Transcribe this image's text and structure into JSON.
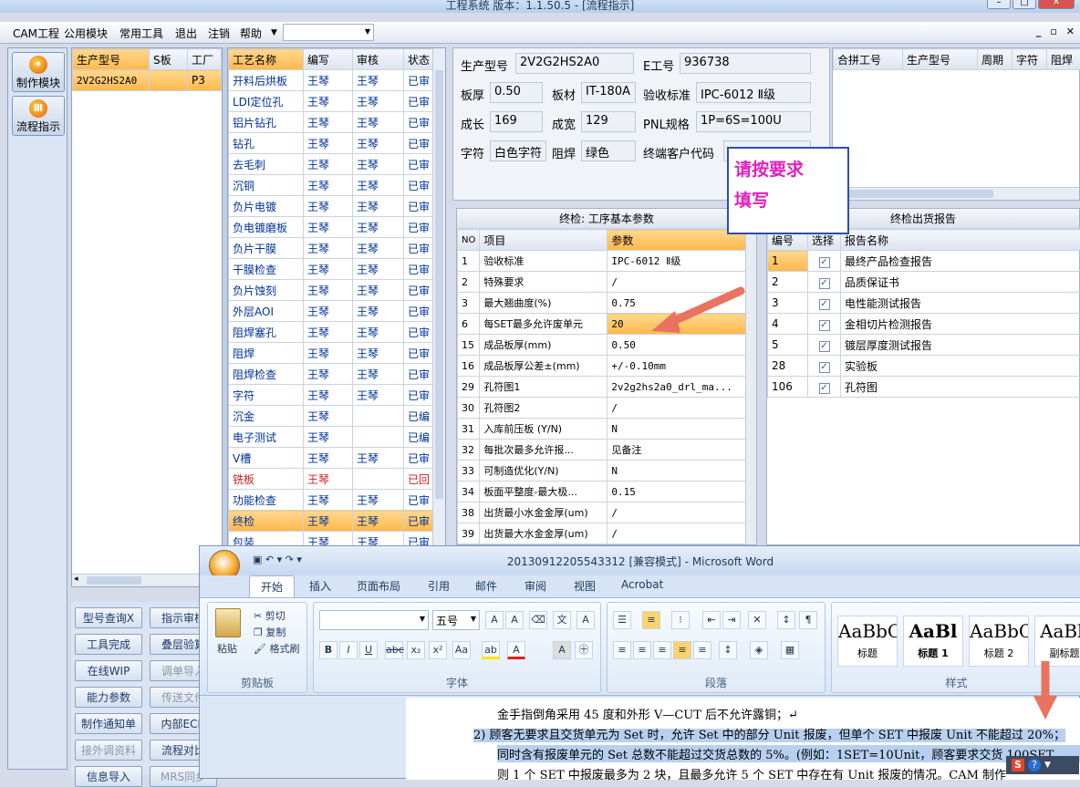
{
  "window_title": "工程系统   版本：1.1.50.5 - [流程指示]",
  "menu": {
    "items": [
      "CAM工程",
      "公用模块",
      "常用工具",
      "退出",
      "注销",
      "帮助"
    ]
  },
  "leftnav": {
    "items": [
      {
        "label": "制作模块",
        "icon": "flame-icon"
      },
      {
        "label": "流程指示",
        "icon": "flow-icon"
      }
    ]
  },
  "product_grid": {
    "headers": [
      "生产型号",
      "S板",
      "工厂"
    ],
    "rows": [
      [
        "2V2G2HS2A0",
        "",
        "P3"
      ]
    ]
  },
  "process_grid": {
    "headers": [
      "工艺名称",
      "编写",
      "审核",
      "状态"
    ],
    "rows": [
      [
        "开料后烘板",
        "王琴",
        "王琴",
        "已审"
      ],
      [
        "LDI定位孔",
        "王琴",
        "王琴",
        "已审"
      ],
      [
        "铝片钻孔",
        "王琴",
        "王琴",
        "已审"
      ],
      [
        "钻孔",
        "王琴",
        "王琴",
        "已审"
      ],
      [
        "去毛刺",
        "王琴",
        "王琴",
        "已审"
      ],
      [
        "沉铜",
        "王琴",
        "王琴",
        "已审"
      ],
      [
        "负片电镀",
        "王琴",
        "王琴",
        "已审"
      ],
      [
        "负电镀磨板",
        "王琴",
        "王琴",
        "已审"
      ],
      [
        "负片干膜",
        "王琴",
        "王琴",
        "已审"
      ],
      [
        "干膜检查",
        "王琴",
        "王琴",
        "已审"
      ],
      [
        "负片蚀刻",
        "王琴",
        "王琴",
        "已审"
      ],
      [
        "外层AOI",
        "王琴",
        "王琴",
        "已审"
      ],
      [
        "阻焊塞孔",
        "王琴",
        "王琴",
        "已审"
      ],
      [
        "阻焊",
        "王琴",
        "王琴",
        "已审"
      ],
      [
        "阻焊检查",
        "王琴",
        "王琴",
        "已审"
      ],
      [
        "字符",
        "王琴",
        "王琴",
        "已审"
      ],
      [
        "沉金",
        "王琴",
        "",
        "已编"
      ],
      [
        "电子测试",
        "王琴",
        "",
        "已编"
      ],
      [
        "V槽",
        "王琴",
        "王琴",
        "已审"
      ],
      [
        "铣板",
        "王琴",
        "",
        "已回"
      ],
      [
        "功能检查",
        "王琴",
        "王琴",
        "已审"
      ],
      [
        "终检",
        "王琴",
        "王琴",
        "已审"
      ],
      [
        "包装",
        "王琴",
        "王琴",
        "已审"
      ]
    ],
    "selected_row": "终检"
  },
  "buttons": [
    "型号查询X",
    "指示审核",
    "工具完成",
    "叠层验算",
    "在线WIP",
    "调单导入",
    "能力参数",
    "传送文件",
    "制作通知单",
    "内部ECN",
    "接外调资料",
    "流程对比",
    "信息导入",
    "MRS同步"
  ],
  "info": {
    "model_label": "生产型号",
    "model": "2V2G2HS2A0",
    "eno_label": "E工号",
    "eno": "936738",
    "thick_label": "板厚",
    "thick": "0.50",
    "material_label": "板材",
    "material": "IT-180A",
    "std_label": "验收标准",
    "std": "IPC-6012 Ⅱ级",
    "len_label": "成长",
    "len": "169",
    "wid_label": "成宽",
    "wid": "129",
    "pnl_label": "PNL规格",
    "pnl": "1P=6S=100U",
    "char_label": "字符",
    "char": "白色字符",
    "mask_label": "阻焊",
    "mask": "绿色",
    "cust_label": "终端客户代码",
    "cust": ""
  },
  "merge_grid": {
    "headers": [
      "合拼工号",
      "生产型号",
      "周期",
      "字符",
      "阻焊"
    ]
  },
  "param_panel": {
    "title": "终检: 工序基本参数",
    "headers": [
      "NO",
      "项目",
      "参数"
    ],
    "rows": [
      [
        "1",
        "验收标准",
        "IPC-6012 Ⅱ级"
      ],
      [
        "2",
        "特殊要求",
        "/"
      ],
      [
        "3",
        "最大翘曲度(%)",
        "0.75"
      ],
      [
        "6",
        "每SET最多允许废单元",
        "20"
      ],
      [
        "15",
        "成品板厚(mm)",
        "0.50"
      ],
      [
        "16",
        "成品板厚公差±(mm)",
        "+/-0.10mm"
      ],
      [
        "29",
        "孔符图1",
        "2v2g2hs2a0_drl_ma..."
      ],
      [
        "30",
        "孔符图2",
        "/"
      ],
      [
        "31",
        "入库前压板 (Y/N)",
        "N"
      ],
      [
        "32",
        "每批次最多允许报...",
        "见备注"
      ],
      [
        "33",
        "可制造优化(Y/N)",
        "N"
      ],
      [
        "34",
        "板面平整度-最大极...",
        "0.15"
      ],
      [
        "38",
        "出货最小水金金厚(um)",
        "/"
      ],
      [
        "39",
        "出货最大水金金厚(um)",
        "/"
      ]
    ]
  },
  "report_panel": {
    "title": "终检出货报告",
    "headers": [
      "编号",
      "选择",
      "报告名称"
    ],
    "rows": [
      [
        "1",
        "最终产品检查报告"
      ],
      [
        "2",
        "品质保证书"
      ],
      [
        "3",
        "电性能测试报告"
      ],
      [
        "4",
        "金相切片检测报告"
      ],
      [
        "5",
        "镀层厚度测试报告"
      ],
      [
        "28",
        "实验板"
      ],
      [
        "106",
        "孔符图"
      ]
    ]
  },
  "callout": {
    "line1": "请按要求",
    "line2": "填写"
  },
  "word": {
    "title": "20130912205543312 [兼容模式] - Microsoft Word",
    "tabs": [
      "开始",
      "插入",
      "页面布局",
      "引用",
      "邮件",
      "审阅",
      "视图",
      "Acrobat"
    ],
    "clipboard": {
      "paste": "粘贴",
      "cut": "剪切",
      "copy": "复制",
      "format": "格式刷",
      "label": "剪贴板"
    },
    "font": {
      "size": "五号",
      "label": "字体"
    },
    "paragraph_label": "段落",
    "styles": [
      {
        "sample": "AaBbC",
        "name": "标题"
      },
      {
        "sample": "AaBl",
        "name": "标题 1"
      },
      {
        "sample": "AaBbC",
        "name": "标题 2"
      },
      {
        "sample": "AaBb",
        "name": "副标题"
      }
    ],
    "styles_label": "样式",
    "doc_lines": [
      "金手指倒角采用 45 度和外形 V—CUT 后不允许露铜；↵",
      "2)   顾客无要求且交货单元为 Set 时，允许 Set 中的部分 Unit 报废，但单个 SET 中报废 Unit 不能超过 20%；",
      "同时含有报废单元的 Set 总数不能超过交货总数的 5%。(例如：1SET=10Unit，顾客要求交货 100SET。",
      "则 1 个 SET 中报废最多为 2 块，且最多允许 5 个 SET 中存在有 Unit 报废的情况。CAM 制作"
    ]
  }
}
